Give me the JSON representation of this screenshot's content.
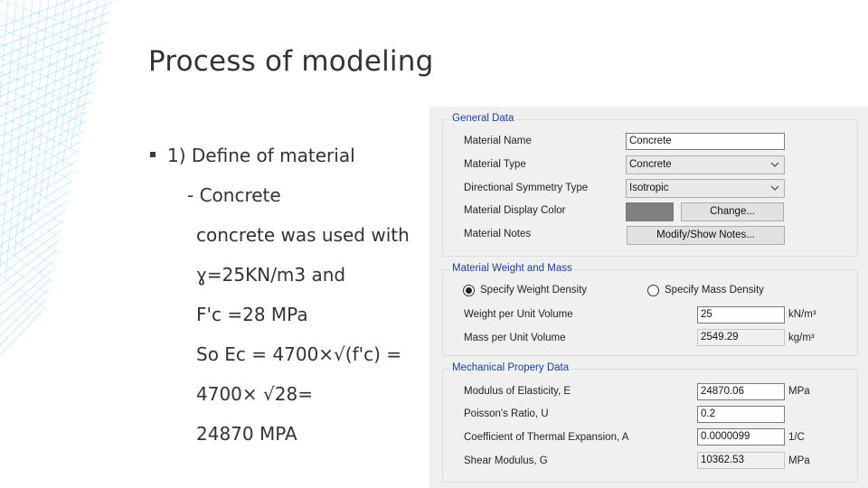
{
  "slide": {
    "title": "Process of modeling",
    "lines": [
      "1) Define of material",
      "- Concrete",
      "concrete was used with",
      "ɣ=25KN/m3 and",
      "F'c =28 MPa",
      "So Ec = 4700×√(f'c) =",
      "4700× √28=",
      "24870 MPA"
    ]
  },
  "dialog": {
    "general": {
      "title": "General Data",
      "material_name_label": "Material Name",
      "material_name_value": "Concrete",
      "material_type_label": "Material Type",
      "material_type_value": "Concrete",
      "directional_label": "Directional Symmetry Type",
      "directional_value": "Isotropic",
      "display_color_label": "Material Display Color",
      "display_color": "#808080",
      "change_button": "Change...",
      "notes_label": "Material Notes",
      "notes_button": "Modify/Show Notes..."
    },
    "weight": {
      "title": "Material Weight and Mass",
      "specify_weight": "Specify Weight Density",
      "specify_mass": "Specify Mass Density",
      "selected": "weight",
      "weight_label": "Weight per Unit Volume",
      "weight_value": "25",
      "weight_unit": "kN/m³",
      "mass_label": "Mass per Unit Volume",
      "mass_value": "2549.29",
      "mass_unit": "kg/m³"
    },
    "mechanical": {
      "title": "Mechanical Propery Data",
      "e_label": "Modulus of Elasticity,  E",
      "e_value": "24870.06",
      "e_unit": "MPa",
      "u_label": "Poisson's Ratio,  U",
      "u_value": "0.2",
      "a_label": "Coefficient of Thermal Expansion,  A",
      "a_value": "0.0000099",
      "a_unit": "1/C",
      "g_label": "Shear Modulus,  G",
      "g_value": "10362.53",
      "g_unit": "MPa"
    }
  },
  "colors": {
    "group_title": "#1c3f96",
    "decoration": "#6ecde6"
  }
}
